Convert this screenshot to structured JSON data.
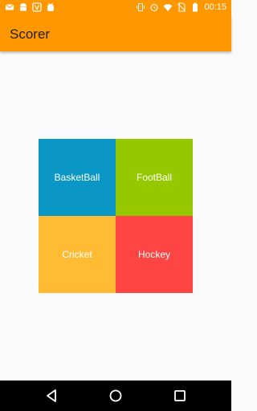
{
  "status_bar": {
    "time": "00:15",
    "left_icons": [
      "mail-icon",
      "android-icon",
      "vpn-icon",
      "android-debug-icon"
    ],
    "right_icons": [
      "vibrate-icon",
      "alarm-icon",
      "wifi-icon",
      "no-sim-icon",
      "battery-icon"
    ]
  },
  "app_bar": {
    "title": "Scorer",
    "color": "#ff9800"
  },
  "tiles": [
    {
      "label": "BasketBall",
      "color": "#0b97c6"
    },
    {
      "label": "FootBall",
      "color": "#96c800"
    },
    {
      "label": "Cricket",
      "color": "#ffbb33"
    },
    {
      "label": "Hockey",
      "color": "#ff4444"
    }
  ],
  "nav_bar": {
    "buttons": [
      "back-icon",
      "home-icon",
      "recents-icon"
    ]
  }
}
